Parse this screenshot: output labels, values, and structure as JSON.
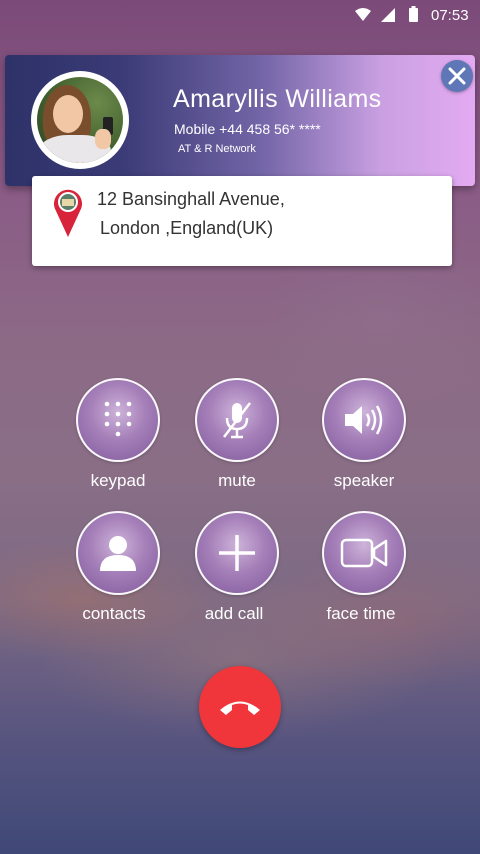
{
  "status_bar": {
    "time": "07:53",
    "icons": [
      "wifi-icon",
      "signal-icon",
      "battery-icon"
    ]
  },
  "caller": {
    "name": "Amaryllis Williams",
    "number": "Mobile +44 458 56* ****",
    "network": "AT & R Network",
    "avatar": "caller-photo",
    "close_icon": "close-icon"
  },
  "location": {
    "line1": "12 Bansinghall Avenue,",
    "line2": "London ,England(UK)",
    "icon": "map-pin-icon"
  },
  "controls": [
    {
      "id": "keypad",
      "label": "keypad",
      "icon": "keypad-icon"
    },
    {
      "id": "mute",
      "label": "mute",
      "icon": "mute-mic-icon"
    },
    {
      "id": "speaker",
      "label": "speaker",
      "icon": "speaker-icon"
    },
    {
      "id": "contacts",
      "label": "contacts",
      "icon": "contacts-icon"
    },
    {
      "id": "add-call",
      "label": "add call",
      "icon": "plus-icon"
    },
    {
      "id": "face-time",
      "label": "face time",
      "icon": "video-camera-icon"
    }
  ],
  "end_call": {
    "icon": "end-call-icon",
    "color": "#f0353b"
  },
  "colors": {
    "accent": "#a57fb8",
    "card_gradient_start": "#2d3268",
    "card_gradient_end": "#e3aaf2",
    "close_button": "#5f77b7"
  }
}
